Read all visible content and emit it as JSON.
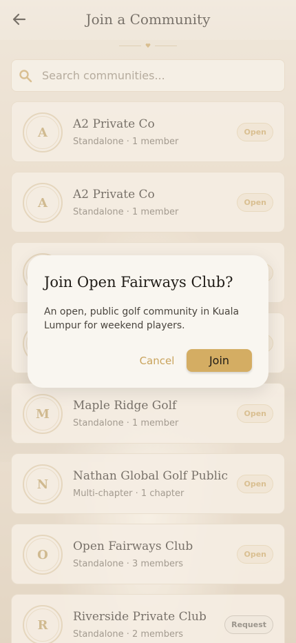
{
  "header": {
    "title": "Join a Community"
  },
  "search": {
    "placeholder": "Search communities..."
  },
  "communities": [
    {
      "initial": "A",
      "name": "A2 Private Co",
      "meta": "Standalone · 1 member",
      "badge": "Open"
    },
    {
      "initial": "A",
      "name": "A2 Private Co",
      "meta": "Standalone · 1 member",
      "badge": "Open"
    },
    {
      "initial": "",
      "name": "",
      "meta": "",
      "badge": ""
    },
    {
      "initial": "",
      "name": "",
      "meta": "",
      "badge": ""
    },
    {
      "initial": "M",
      "name": "Maple Ridge Golf",
      "meta": "Standalone · 1 member",
      "badge": "Open"
    },
    {
      "initial": "N",
      "name": "Nathan Global Golf Public",
      "meta": "Multi-chapter · 1 chapter",
      "badge": "Open"
    },
    {
      "initial": "O",
      "name": "Open Fairways Club",
      "meta": "Standalone · 3 members",
      "badge": "Open"
    },
    {
      "initial": "R",
      "name": "Riverside Private Club",
      "meta": "Standalone · 2 members",
      "badge": "Request"
    }
  ],
  "dialog": {
    "title": "Join Open Fairways Club?",
    "body": "An open, public golf community in Kuala Lumpur for weekend players.",
    "cancel_label": "Cancel",
    "join_label": "Join"
  },
  "colors": {
    "accent": "#d4ad63",
    "accent_text": "#c9a35c",
    "background": "#e8dccb"
  }
}
